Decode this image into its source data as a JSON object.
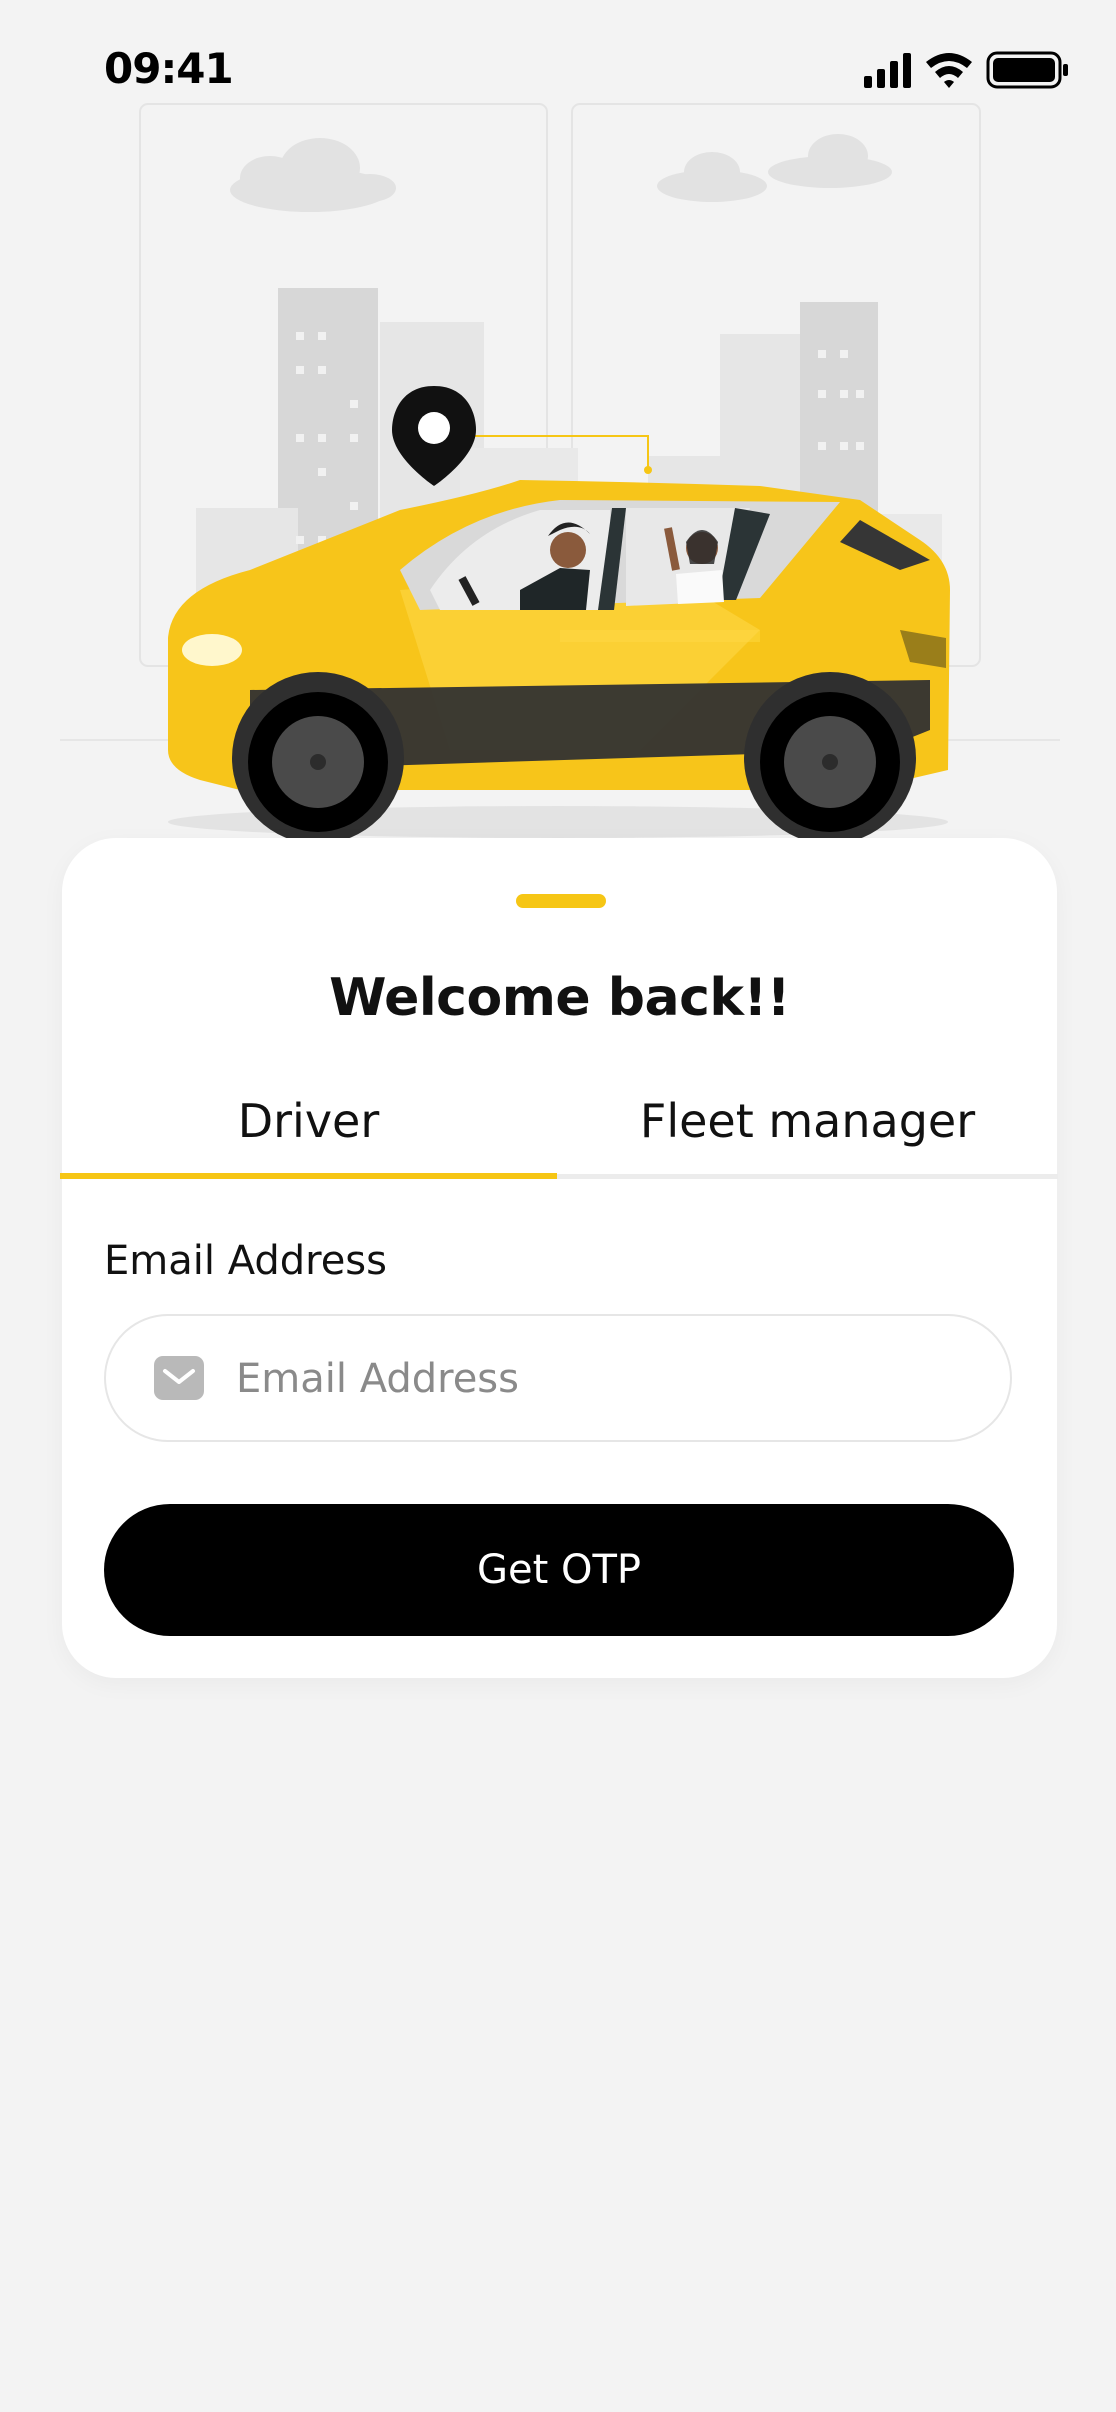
{
  "status_bar": {
    "time": "09:41"
  },
  "icons": {
    "signal": "cellular-signal-icon",
    "wifi": "wifi-icon",
    "battery": "battery-icon",
    "location": "location-pin-icon",
    "email": "mail-icon"
  },
  "login": {
    "title": "Welcome back!!",
    "tabs": [
      {
        "label": "Driver",
        "active": true
      },
      {
        "label": "Fleet manager",
        "active": false
      }
    ],
    "email_label": "Email Address",
    "email_placeholder": "Email Address",
    "email_value": "",
    "submit_label": "Get OTP"
  },
  "colors": {
    "accent": "#f6c615",
    "button": "#000000",
    "background": "#f3f3f3",
    "card": "#ffffff"
  }
}
